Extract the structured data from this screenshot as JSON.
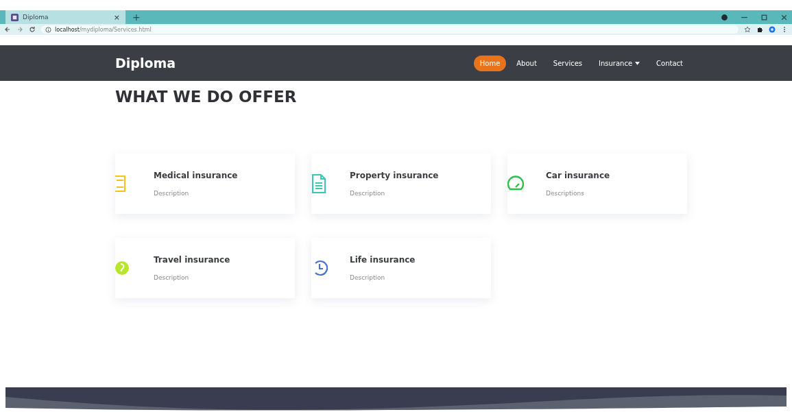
{
  "browser": {
    "tab_title": "Diploma",
    "close_glyph": "×",
    "new_tab_glyph": "+",
    "url_host": "localhost",
    "url_path": "/mydiploma/Services.html"
  },
  "navbar": {
    "brand": "Diploma",
    "links": [
      {
        "label": "Home",
        "selected": true,
        "dropdown": false
      },
      {
        "label": "About",
        "selected": false,
        "dropdown": false
      },
      {
        "label": "Services",
        "selected": false,
        "dropdown": false
      },
      {
        "label": "Insurance",
        "selected": false,
        "dropdown": true
      },
      {
        "label": "Contact",
        "selected": false,
        "dropdown": false
      }
    ]
  },
  "heading": "WHAT WE DO OFFER",
  "services": [
    {
      "kind": "list",
      "color": "#f0c419",
      "title": "Medical insurance",
      "description": "Description"
    },
    {
      "kind": "document",
      "color": "#3cc7b5",
      "title": "Property insurance",
      "description": "Description"
    },
    {
      "kind": "gauge",
      "color": "#2fbf4a",
      "title": "Car insurance",
      "description": "Descriptions"
    },
    {
      "kind": "globe",
      "color": "#b8e62e",
      "title": "Travel insurance",
      "description": "Description"
    },
    {
      "kind": "clock",
      "color": "#4a6fd1",
      "title": "Life insurance",
      "description": "Description"
    }
  ]
}
